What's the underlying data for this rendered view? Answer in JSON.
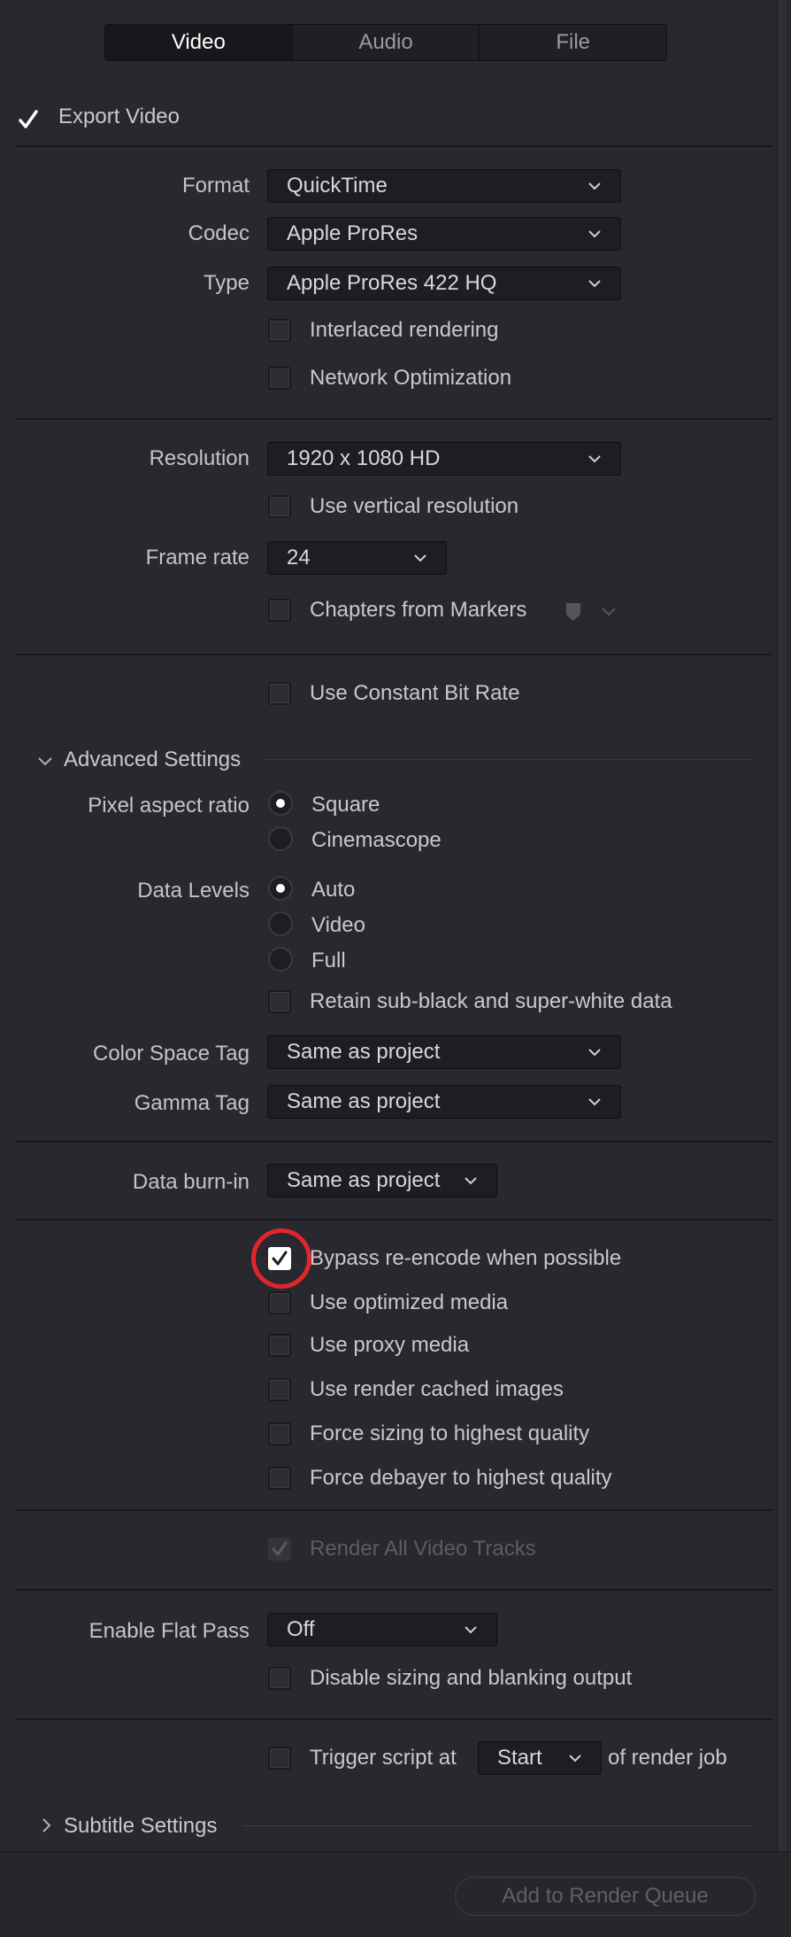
{
  "tabs": [
    {
      "label": "Video",
      "active": true
    },
    {
      "label": "Audio",
      "active": false
    },
    {
      "label": "File",
      "active": false
    }
  ],
  "export_video": {
    "label": "Export Video",
    "checked": true
  },
  "format": {
    "label": "Format",
    "value": "QuickTime"
  },
  "codec": {
    "label": "Codec",
    "value": "Apple ProRes"
  },
  "type": {
    "label": "Type",
    "value": "Apple ProRes 422 HQ"
  },
  "interlaced": {
    "label": "Interlaced rendering",
    "checked": false
  },
  "network_opt": {
    "label": "Network Optimization",
    "checked": false
  },
  "resolution": {
    "label": "Resolution",
    "value": "1920 x 1080 HD"
  },
  "vertical_res": {
    "label": "Use vertical resolution",
    "checked": false
  },
  "frame_rate": {
    "label": "Frame rate",
    "value": "24"
  },
  "chapters": {
    "label": "Chapters from Markers",
    "checked": false
  },
  "constant_bitrate": {
    "label": "Use Constant Bit Rate",
    "checked": false
  },
  "advanced": {
    "title": "Advanced Settings",
    "expanded": true
  },
  "pixel_aspect": {
    "label": "Pixel aspect ratio",
    "options": [
      {
        "label": "Square",
        "selected": true
      },
      {
        "label": "Cinemascope",
        "selected": false
      }
    ]
  },
  "data_levels": {
    "label": "Data Levels",
    "options": [
      {
        "label": "Auto",
        "selected": true
      },
      {
        "label": "Video",
        "selected": false
      },
      {
        "label": "Full",
        "selected": false
      }
    ]
  },
  "retain_subblack": {
    "label": "Retain sub-black and super-white data",
    "checked": false
  },
  "color_space": {
    "label": "Color Space Tag",
    "value": "Same as project"
  },
  "gamma": {
    "label": "Gamma Tag",
    "value": "Same as project"
  },
  "burn_in": {
    "label": "Data burn-in",
    "value": "Same as project"
  },
  "bypass": {
    "label": "Bypass re-encode when possible",
    "checked": true,
    "highlighted": true,
    "highlight_color": "#e0262b"
  },
  "optimized": {
    "label": "Use optimized media",
    "checked": false
  },
  "proxy": {
    "label": "Use proxy media",
    "checked": false
  },
  "render_cached": {
    "label": "Use render cached images",
    "checked": false
  },
  "force_sizing": {
    "label": "Force sizing to highest quality",
    "checked": false
  },
  "force_debayer": {
    "label": "Force debayer to highest quality",
    "checked": false
  },
  "render_all_tracks": {
    "label": "Render All Video Tracks",
    "checked": true,
    "disabled": true
  },
  "flat_pass": {
    "label": "Enable Flat Pass",
    "value": "Off"
  },
  "disable_sizing": {
    "label": "Disable sizing and blanking output",
    "checked": false
  },
  "trigger": {
    "prefix": "Trigger script at",
    "value": "Start",
    "suffix": "of render job",
    "checked": false
  },
  "subtitle": {
    "title": "Subtitle Settings",
    "expanded": false
  },
  "add_queue": {
    "label": "Add to Render Queue",
    "disabled": true
  }
}
